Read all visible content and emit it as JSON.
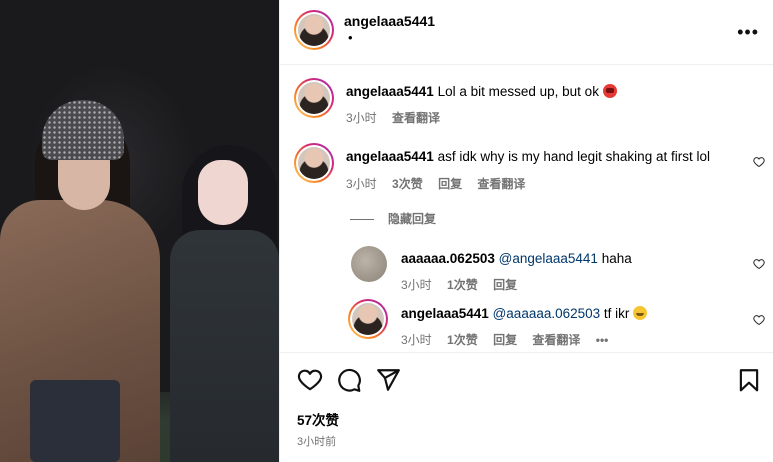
{
  "post": {
    "username": "angelaaa5441",
    "subtitle": "•"
  },
  "comments": [
    {
      "username": "angelaaa5441",
      "text": "Lol a bit messed up, but ok",
      "time": "3小时",
      "translate": "查看翻译"
    },
    {
      "username": "angelaaa5441",
      "text": "asf idk why is my hand legit shaking at first lol",
      "time": "3小时",
      "likes": "3次赞",
      "reply": "回复",
      "translate": "查看翻译",
      "hide_replies": "隐藏回复",
      "replies": [
        {
          "username": "aaaaaa.062503",
          "mention": "@angelaaa5441",
          "text": "haha",
          "time": "3小时",
          "likes": "1次赞",
          "reply": "回复"
        },
        {
          "username": "angelaaa5441",
          "mention": "@aaaaaa.062503",
          "text": "tf ikr",
          "time": "3小时",
          "likes": "1次赞",
          "reply": "回复",
          "translate": "查看翻译",
          "more": "•••"
        }
      ]
    }
  ],
  "footer": {
    "likes": "57次赞",
    "time_ago": "3小时前"
  },
  "icons": {
    "like": "heart-icon",
    "comment": "comment-icon",
    "share": "share-icon",
    "save": "bookmark-icon",
    "more": "more-icon"
  }
}
